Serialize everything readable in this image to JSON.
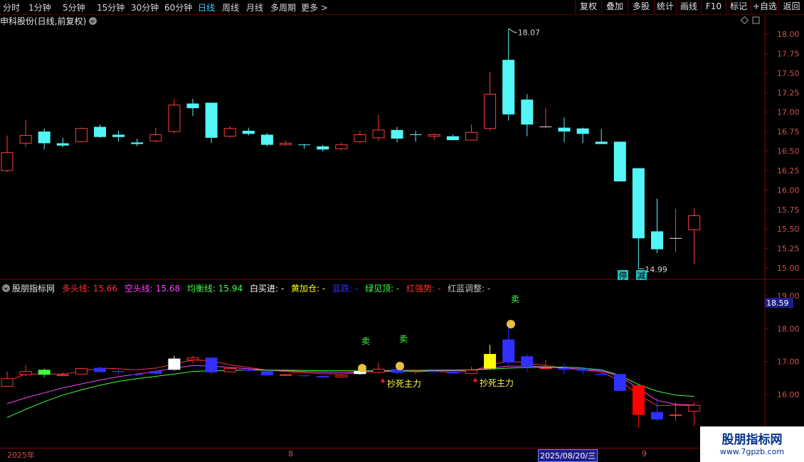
{
  "toolbar": {
    "timeframes": [
      "分时",
      "1分钟",
      "5分钟",
      "15分钟",
      "30分钟",
      "60分钟",
      "日线",
      "周线",
      "月线",
      "多周期",
      "更多 >"
    ],
    "active_timeframe": "日线",
    "right_buttons": [
      "复权",
      "叠加",
      "多股",
      "统计",
      "画线",
      "F10",
      "标记",
      "+自选",
      "返回"
    ]
  },
  "stock_title": "申科股份(日线,前复权)",
  "indicator_bar": {
    "name": "股朋指标网",
    "items": [
      {
        "label": "多头线: 15.66",
        "color": "#ff3030"
      },
      {
        "label": "空头线: 15.68",
        "color": "#ff40ff"
      },
      {
        "label": "均衡线: 15.94",
        "color": "#40ff40"
      },
      {
        "label": "白买进: -",
        "color": "#ffffff"
      },
      {
        "label": "黄加仓: -",
        "color": "#ffff00"
      },
      {
        "label": "蓝跌: -",
        "color": "#3030ff"
      },
      {
        "label": "绿见顶: -",
        "color": "#40ff40"
      },
      {
        "label": "红强势: -",
        "color": "#ff3030"
      },
      {
        "label": "红蓝调整: -",
        "color": "#c0c0c0"
      }
    ]
  },
  "price_axis": {
    "ticks": [
      "18.00",
      "17.75",
      "17.50",
      "17.25",
      "17.00",
      "16.75",
      "16.50",
      "16.25",
      "16.00",
      "15.75",
      "15.50",
      "15.25",
      "15.00"
    ]
  },
  "indicator_axis": {
    "ticks": [
      "19.00",
      "18.00",
      "17.00",
      "16.00"
    ],
    "current": "18.59"
  },
  "annotations": {
    "high": "18.07",
    "low": "14.99",
    "tag1": "停",
    "tag2": "减",
    "sell1": "卖",
    "sell2": "卖",
    "sell3": "卖",
    "signal1": "抄死主力",
    "signal2": "抄死主力"
  },
  "bottom_axis": {
    "year": "2025年",
    "month1": "8",
    "cursor_date": "2025/08/20/三",
    "month2": "9"
  },
  "watermark": {
    "title": "股朋指标网",
    "url": "www.7gpzb.com"
  },
  "colors": {
    "up": "#ff3c3c",
    "down": "#53f6f6",
    "background": "#000000",
    "grid": "#8a0000"
  },
  "chart_data": {
    "type": "candlestick",
    "title": "申科股份(日线,前复权)",
    "ylim": [
      14.9,
      18.15
    ],
    "candles": [
      {
        "o": 16.25,
        "h": 16.7,
        "l": 16.23,
        "c": 16.48
      },
      {
        "o": 16.6,
        "h": 16.9,
        "l": 16.56,
        "c": 16.7
      },
      {
        "o": 16.75,
        "h": 16.79,
        "l": 16.52,
        "c": 16.6
      },
      {
        "o": 16.6,
        "h": 16.67,
        "l": 16.55,
        "c": 16.57
      },
      {
        "o": 16.62,
        "h": 16.8,
        "l": 16.62,
        "c": 16.79
      },
      {
        "o": 16.81,
        "h": 16.84,
        "l": 16.67,
        "c": 16.68
      },
      {
        "o": 16.71,
        "h": 16.76,
        "l": 16.62,
        "c": 16.68
      },
      {
        "o": 16.61,
        "h": 16.66,
        "l": 16.56,
        "c": 16.59
      },
      {
        "o": 16.63,
        "h": 16.8,
        "l": 16.61,
        "c": 16.71
      },
      {
        "o": 16.75,
        "h": 17.17,
        "l": 16.73,
        "c": 17.09
      },
      {
        "o": 17.11,
        "h": 17.17,
        "l": 16.95,
        "c": 17.05
      },
      {
        "o": 17.12,
        "h": 17.12,
        "l": 16.6,
        "c": 16.67
      },
      {
        "o": 16.69,
        "h": 16.82,
        "l": 16.67,
        "c": 16.79
      },
      {
        "o": 16.76,
        "h": 16.8,
        "l": 16.7,
        "c": 16.72
      },
      {
        "o": 16.71,
        "h": 16.73,
        "l": 16.56,
        "c": 16.58
      },
      {
        "o": 16.58,
        "h": 16.63,
        "l": 16.57,
        "c": 16.6
      },
      {
        "o": 16.58,
        "h": 16.59,
        "l": 16.53,
        "c": 16.57
      },
      {
        "o": 16.56,
        "h": 16.58,
        "l": 16.49,
        "c": 16.52
      },
      {
        "o": 16.53,
        "h": 16.61,
        "l": 16.51,
        "c": 16.58
      },
      {
        "o": 16.62,
        "h": 16.76,
        "l": 16.6,
        "c": 16.71
      },
      {
        "o": 16.67,
        "h": 16.96,
        "l": 16.63,
        "c": 16.77
      },
      {
        "o": 16.77,
        "h": 16.81,
        "l": 16.61,
        "c": 16.66
      },
      {
        "o": 16.71,
        "h": 16.76,
        "l": 16.62,
        "c": 16.7
      },
      {
        "o": 16.69,
        "h": 16.73,
        "l": 16.64,
        "c": 16.71
      },
      {
        "o": 16.69,
        "h": 16.71,
        "l": 16.64,
        "c": 16.64
      },
      {
        "o": 16.64,
        "h": 16.84,
        "l": 16.64,
        "c": 16.74
      },
      {
        "o": 16.79,
        "h": 17.51,
        "l": 16.76,
        "c": 17.23
      },
      {
        "o": 17.67,
        "h": 18.07,
        "l": 16.89,
        "c": 16.97
      },
      {
        "o": 17.16,
        "h": 17.23,
        "l": 16.69,
        "c": 16.84
      },
      {
        "o": 16.81,
        "h": 17.05,
        "l": 16.8,
        "c": 16.81
      },
      {
        "o": 16.8,
        "h": 16.93,
        "l": 16.61,
        "c": 16.75
      },
      {
        "o": 16.79,
        "h": 16.8,
        "l": 16.6,
        "c": 16.72
      },
      {
        "o": 16.62,
        "h": 16.78,
        "l": 16.6,
        "c": 16.59
      },
      {
        "o": 16.62,
        "h": 16.62,
        "l": 16.11,
        "c": 16.11
      },
      {
        "o": 16.28,
        "h": 16.28,
        "l": 14.99,
        "c": 15.38
      },
      {
        "o": 15.47,
        "h": 15.89,
        "l": 15.19,
        "c": 15.24
      },
      {
        "o": 15.38,
        "h": 15.76,
        "l": 15.2,
        "c": 15.38
      },
      {
        "o": 15.49,
        "h": 15.77,
        "l": 15.05,
        "c": 15.67
      }
    ],
    "indicator": {
      "ylim": [
        15.3,
        19.2
      ],
      "series": [
        {
          "name": "多头线",
          "color": "#ff3030",
          "values": [
            16.4,
            16.62,
            16.62,
            16.62,
            16.7,
            16.8,
            16.78,
            16.75,
            16.8,
            16.92,
            17.05,
            17.02,
            16.9,
            16.82,
            16.74,
            16.7,
            16.66,
            16.63,
            16.62,
            16.66,
            16.72,
            16.72,
            16.7,
            16.7,
            16.68,
            16.7,
            16.9,
            17.02,
            16.95,
            16.88,
            16.8,
            16.75,
            16.68,
            16.42,
            15.99,
            15.66,
            15.68,
            15.66
          ]
        },
        {
          "name": "空头线",
          "color": "#ff40ff",
          "values": [
            15.72,
            15.9,
            16.05,
            16.2,
            16.32,
            16.44,
            16.54,
            16.62,
            16.7,
            16.8,
            16.88,
            16.86,
            16.82,
            16.78,
            16.74,
            16.72,
            16.7,
            16.68,
            16.67,
            16.68,
            16.7,
            16.71,
            16.71,
            16.72,
            16.72,
            16.74,
            16.8,
            16.86,
            16.86,
            16.84,
            16.8,
            16.76,
            16.72,
            16.55,
            16.18,
            15.82,
            15.7,
            15.68
          ]
        },
        {
          "name": "均衡线",
          "color": "#40ff40",
          "values": [
            15.3,
            15.55,
            15.78,
            15.98,
            16.14,
            16.28,
            16.4,
            16.48,
            16.55,
            16.62,
            16.7,
            16.72,
            16.73,
            16.74,
            16.74,
            16.74,
            16.73,
            16.72,
            16.72,
            16.72,
            16.72,
            16.73,
            16.73,
            16.74,
            16.74,
            16.75,
            16.77,
            16.8,
            16.82,
            16.83,
            16.83,
            16.8,
            16.75,
            16.58,
            16.3,
            16.1,
            15.98,
            15.94
          ]
        }
      ]
    }
  }
}
